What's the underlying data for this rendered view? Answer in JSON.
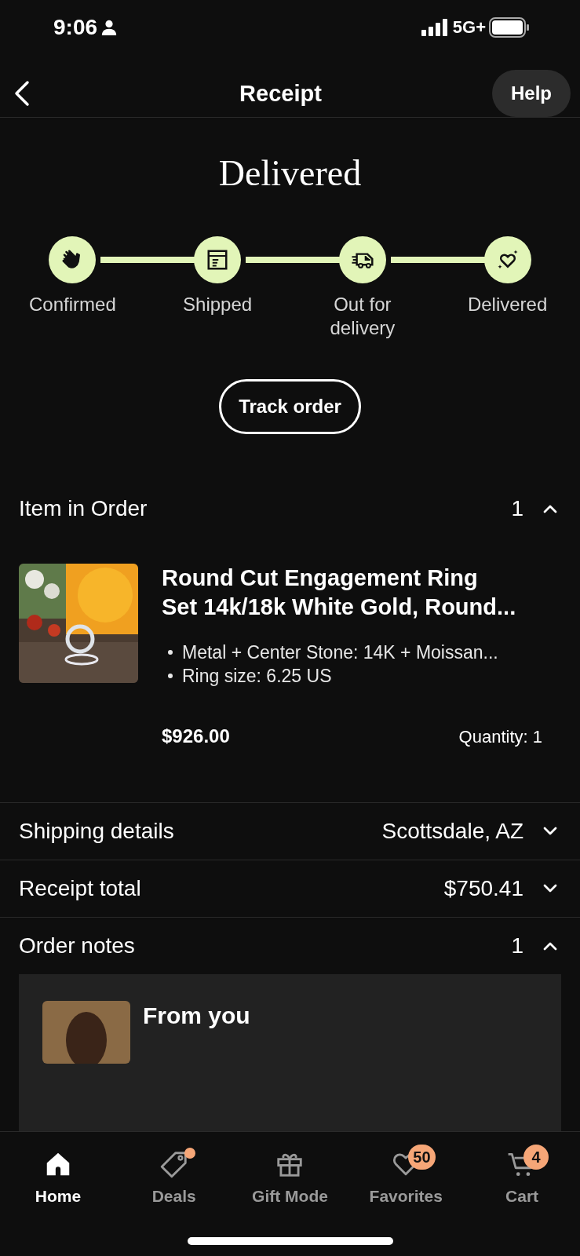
{
  "status_bar": {
    "time": "9:06",
    "network": "5G+"
  },
  "header": {
    "title": "Receipt",
    "help": "Help"
  },
  "status_title": "Delivered",
  "steps": [
    {
      "kind": "confirmed",
      "label": "Confirmed",
      "done": true
    },
    {
      "kind": "shipped",
      "label": "Shipped",
      "done": true
    },
    {
      "kind": "out",
      "label": "Out for delivery",
      "done": true
    },
    {
      "kind": "delivered",
      "label": "Delivered",
      "done": true
    }
  ],
  "track_button": "Track order",
  "items_section": {
    "label": "Item in Order",
    "count": "1",
    "expanded": true
  },
  "item": {
    "title": "Round Cut Engagement Ring Set 14k/18k White Gold, Round...",
    "options": [
      "Metal + Center Stone: 14K + Moissan...",
      "Ring size: 6.25 US"
    ],
    "price": "$926.00",
    "quantity": "Quantity: 1"
  },
  "rows": [
    {
      "label": "Shipping details",
      "value": "Scottsdale, AZ",
      "expanded": false
    },
    {
      "label": "Receipt total",
      "value": "$750.41",
      "expanded": false
    },
    {
      "label": "Order notes",
      "value": "1",
      "expanded": true
    }
  ],
  "note": {
    "title": "From you"
  },
  "nav": [
    {
      "kind": "home",
      "label": "Home",
      "selected": true
    },
    {
      "kind": "deals",
      "label": "Deals",
      "selected": false,
      "dot": true
    },
    {
      "kind": "gift",
      "label": "Gift Mode",
      "selected": false
    },
    {
      "kind": "favorites",
      "label": "Favorites",
      "selected": false,
      "badge": "50"
    },
    {
      "kind": "cart",
      "label": "Cart",
      "selected": false,
      "badge": "4"
    }
  ]
}
